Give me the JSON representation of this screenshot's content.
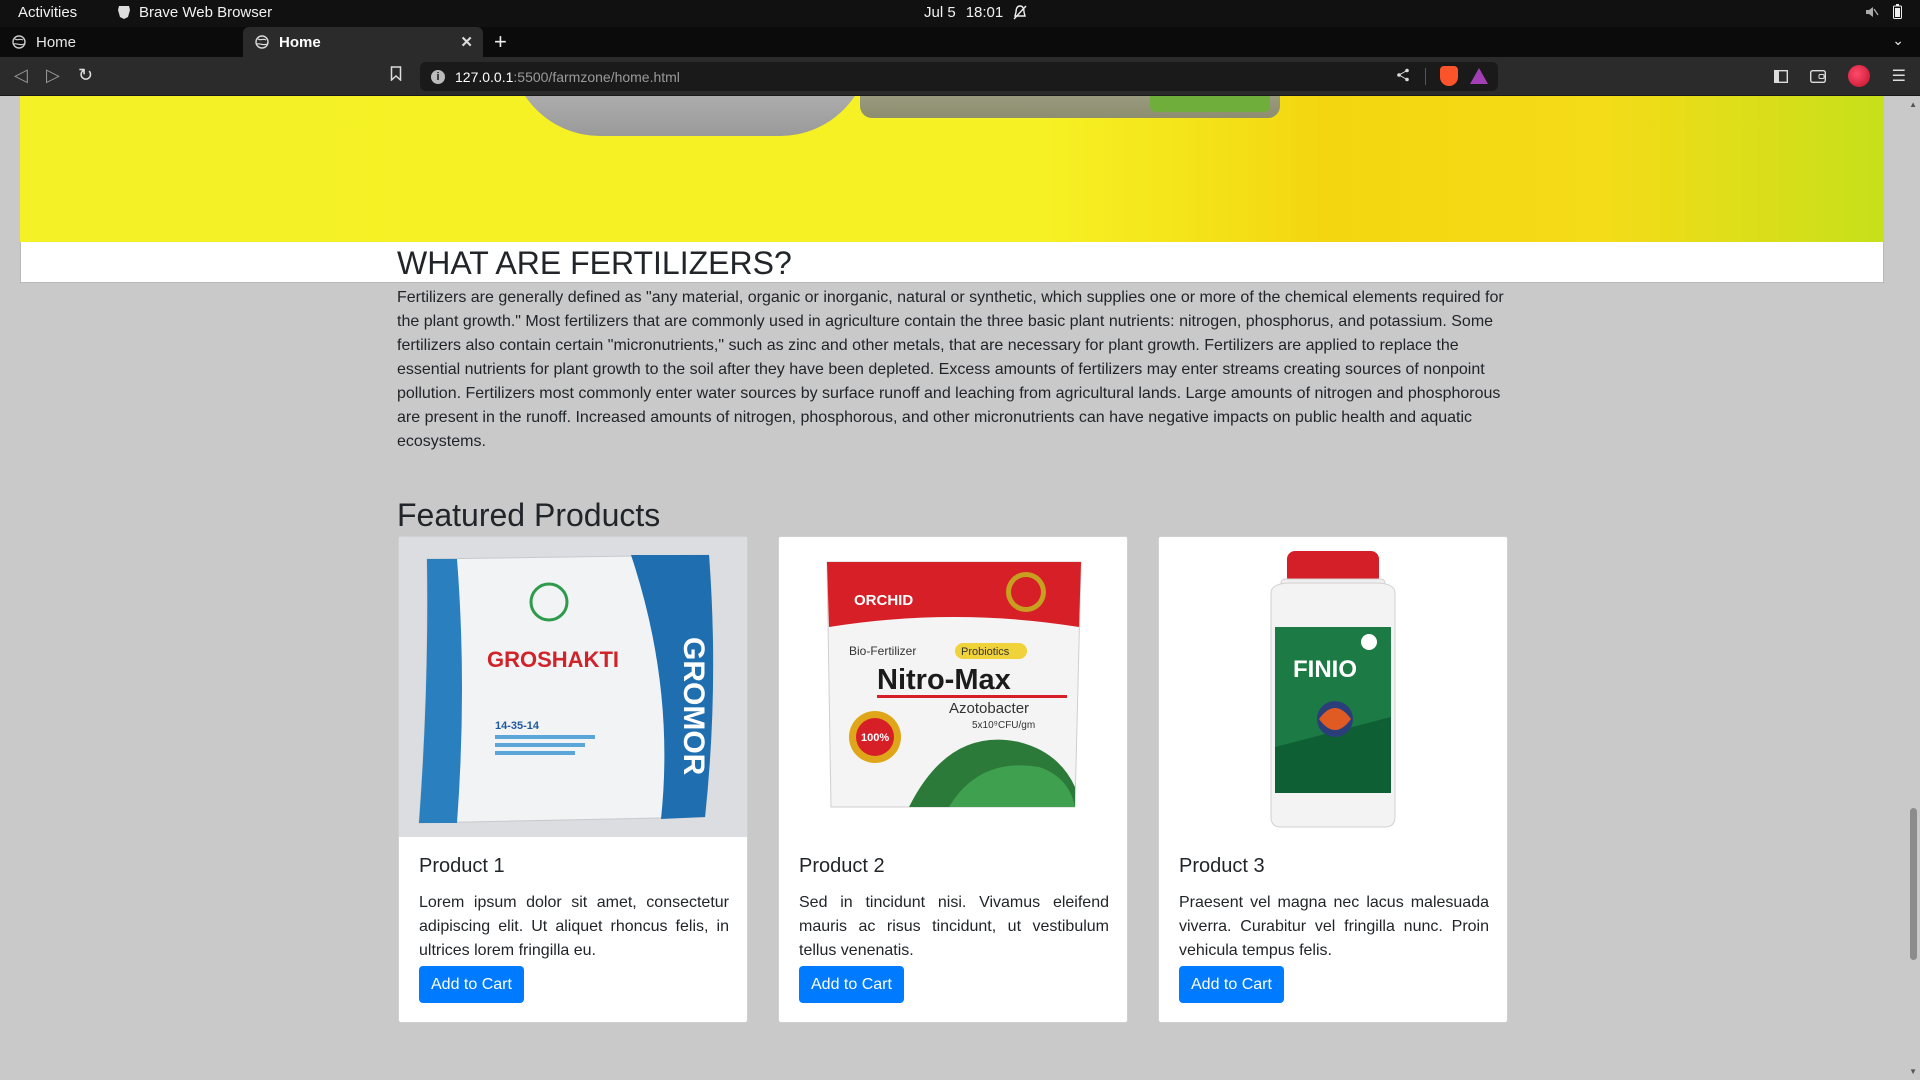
{
  "system_bar": {
    "activities": "Activities",
    "app_name": "Brave Web Browser",
    "date": "Jul 5",
    "time": "18:01"
  },
  "browser": {
    "tabs": [
      {
        "label": "Home",
        "active": false
      },
      {
        "label": "Home",
        "active": true
      }
    ],
    "url_host": "127.0.0.1",
    "url_path": ":5500/farmzone/home.html"
  },
  "article": {
    "heading": "WHAT ARE FERTILIZERS?",
    "body": "Fertilizers are generally defined as \"any material, organic or inorganic, natural or synthetic, which supplies one or more of the chemical elements required for the plant growth.\" Most fertilizers that are commonly used in agriculture contain the three basic plant nutrients: nitrogen, phosphorus, and potassium. Some fertilizers also contain certain \"micronutrients,\" such as zinc and other metals, that are necessary for plant growth. Fertilizers are applied to replace the essential nutrients for plant growth to the soil after they have been depleted. Excess amounts of fertilizers may enter streams creating sources of nonpoint pollution. Fertilizers most commonly enter water sources by surface runoff and leaching from agricultural lands. Large amounts of nitrogen and phosphorous are present in the runoff. Increased amounts of nitrogen, phosphorous, and other micronutrients can have negative impacts on public health and aquatic ecosystems."
  },
  "featured": {
    "heading": "Featured Products",
    "products": [
      {
        "title": "Product 1",
        "description": "Lorem ipsum dolor sit amet, consectetur adipiscing elit. Ut aliquet rhoncus felis, in ultrices lorem fringilla eu.",
        "button": "Add to Cart",
        "image_text": {
          "brand": "GROSHAKTI",
          "side": "GROMOR",
          "grade": "14-35-14"
        }
      },
      {
        "title": "Product 2",
        "description": "Sed in tincidunt nisi. Vivamus eleifend mauris ac risus tincidunt, ut vestibulum tellus venenatis.",
        "button": "Add to Cart",
        "image_text": {
          "brand": "ORCHID",
          "type": "Bio-Fertilizer",
          "tag": "Probiotics",
          "name": "Nitro-Max",
          "sub": "Azotobacter",
          "cfu": "5x10⁹CFU/gm",
          "seal": "100%"
        }
      },
      {
        "title": "Product 3",
        "description": "Praesent vel magna nec lacus malesuada viverra. Curabitur vel fringilla nunc. Proin vehicula tempus felis.",
        "button": "Add to Cart",
        "image_text": {
          "brand": "FINIO"
        }
      }
    ]
  },
  "colors": {
    "primary_button": "#007bff",
    "page_background": "#c9c9c9",
    "hero_yellow": "#f4f126"
  }
}
